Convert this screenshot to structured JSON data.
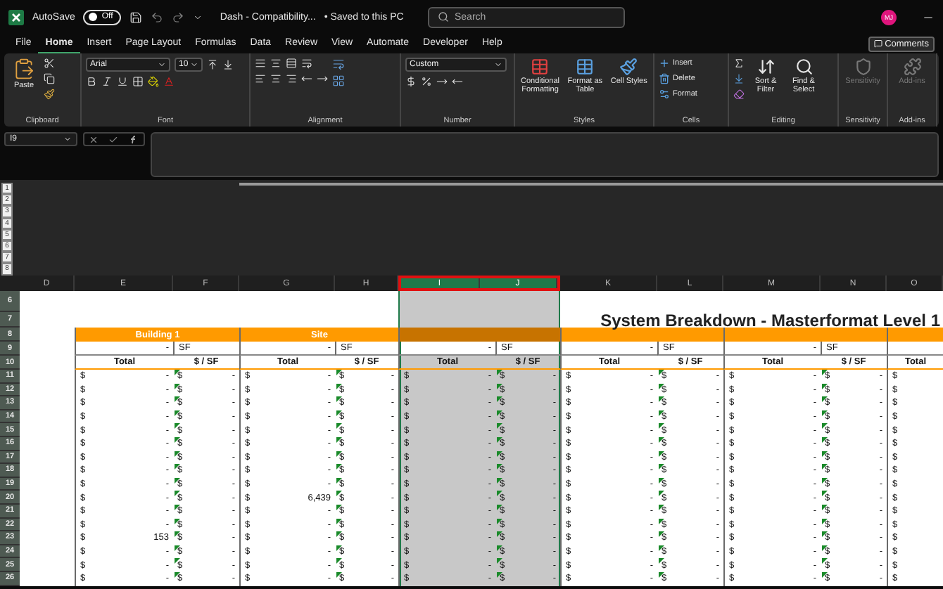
{
  "title_bar": {
    "autosave": {
      "label": "AutoSave",
      "on": false,
      "state_label": "Off"
    },
    "document": "Dash  -  Compatibility...",
    "save_status": "• Saved to this PC",
    "search": {
      "placeholder": "Search"
    },
    "avatar": "MJ"
  },
  "menu": [
    {
      "label": "File",
      "selected": false
    },
    {
      "label": "Home",
      "selected": true
    },
    {
      "label": "Insert",
      "selected": false
    },
    {
      "label": "Page Layout",
      "selected": false
    },
    {
      "label": "Formulas",
      "selected": false
    },
    {
      "label": "Data",
      "selected": false
    },
    {
      "label": "Review",
      "selected": false
    },
    {
      "label": "View",
      "selected": false
    },
    {
      "label": "Automate",
      "selected": false
    },
    {
      "label": "Developer",
      "selected": false
    },
    {
      "label": "Help",
      "selected": false
    }
  ],
  "comments_button": "Comments",
  "ribbon": [
    {
      "kind": "clipboard",
      "name": "Clipboard",
      "buttons": [
        {
          "label": "Paste",
          "disabled": false
        }
      ]
    },
    {
      "kind": "font",
      "name": "Font",
      "font": "Arial",
      "size": "10"
    },
    {
      "kind": "alignment",
      "name": "Alignment"
    },
    {
      "kind": "number",
      "name": "Number",
      "format": "Custom"
    },
    {
      "kind": "styles",
      "name": "Styles",
      "buttons": [
        {
          "label": "Conditional Formatting",
          "disabled": false
        },
        {
          "label": "Format as Table",
          "disabled": false
        },
        {
          "label": "Cell Styles",
          "disabled": false
        }
      ]
    },
    {
      "kind": "cells",
      "name": "Cells",
      "buttons": [
        {
          "label": "Insert",
          "disabled": false
        },
        {
          "label": "Delete",
          "disabled": false
        },
        {
          "label": "Format",
          "disabled": false
        }
      ]
    },
    {
      "kind": "editing",
      "name": "Editing",
      "buttons": [
        {
          "label": "Sort & Filter",
          "disabled": false
        },
        {
          "label": "Find & Select",
          "disabled": false
        }
      ]
    },
    {
      "kind": "single",
      "name": "Sensitivity",
      "buttons": [
        {
          "label": "Sensitivity",
          "disabled": true
        }
      ]
    },
    {
      "kind": "single",
      "name": "Add-ins",
      "buttons": [
        {
          "label": "Add-ins",
          "disabled": true
        }
      ]
    }
  ],
  "formula_bar": {
    "name_box": "I9"
  },
  "top_pane": {
    "rows": [
      "1",
      "2",
      "3",
      "4",
      "5",
      "6",
      "7",
      "8"
    ]
  },
  "sheet": {
    "columns": [
      {
        "letter": "D",
        "selected": false
      },
      {
        "letter": "E",
        "selected": false
      },
      {
        "letter": "F",
        "selected": false
      },
      {
        "letter": "G",
        "selected": false
      },
      {
        "letter": "H",
        "selected": false
      },
      {
        "letter": "I",
        "selected": true
      },
      {
        "letter": "J",
        "selected": true
      },
      {
        "letter": "K",
        "selected": false
      },
      {
        "letter": "L",
        "selected": false
      },
      {
        "letter": "M",
        "selected": false
      },
      {
        "letter": "N",
        "selected": false
      },
      {
        "letter": "O",
        "selected": false
      }
    ],
    "rows": [
      {
        "number": "6",
        "kind": "blank"
      },
      {
        "number": "7",
        "kind": "title",
        "text": "System Breakdown - Masterformat Level 1"
      },
      {
        "number": "8",
        "kind": "block_header",
        "blocks": [
          {
            "label": "Building 1",
            "selected": false
          },
          {
            "label": "Site",
            "selected": false
          },
          {
            "selected": true
          },
          {
            "selected": false
          },
          {
            "selected": false
          },
          {
            "selected": false
          }
        ]
      },
      {
        "number": "9",
        "kind": "area",
        "cells": [
          [
            "-",
            "SF"
          ],
          [
            "-",
            "SF"
          ],
          [
            "-",
            "SF"
          ],
          [
            "-",
            "SF"
          ],
          [
            "-",
            "SF"
          ],
          []
        ]
      },
      {
        "number": "10",
        "kind": "heading",
        "cells": [
          [
            "Total",
            "$ / SF"
          ],
          [
            "Total",
            "$ / SF"
          ],
          [
            "Total",
            "$ / SF"
          ],
          [
            "Total",
            "$ / SF"
          ],
          [
            "Total",
            "$ / SF"
          ],
          [
            "Total"
          ]
        ]
      },
      {
        "number": "11",
        "kind": "data",
        "flagged": true,
        "cells": [
          [
            "$",
            "-",
            "$",
            "-"
          ],
          [
            "$",
            "-",
            "$",
            "-"
          ],
          [
            "$",
            "-",
            "$",
            "-"
          ],
          [
            "$",
            "-",
            "$",
            "-"
          ],
          [
            "$",
            "-",
            "$",
            "-"
          ],
          [
            "$"
          ]
        ]
      },
      {
        "number": "12",
        "kind": "data",
        "flagged": true,
        "cells": [
          [
            "$",
            "-",
            "$",
            "-"
          ],
          [
            "$",
            "-",
            "$",
            "-"
          ],
          [
            "$",
            "-",
            "$",
            "-"
          ],
          [
            "$",
            "-",
            "$",
            "-"
          ],
          [
            "$",
            "-",
            "$",
            "-"
          ],
          [
            "$"
          ]
        ]
      },
      {
        "number": "13",
        "kind": "data",
        "flagged": true,
        "cells": [
          [
            "$",
            "-",
            "$",
            "-"
          ],
          [
            "$",
            "-",
            "$",
            "-"
          ],
          [
            "$",
            "-",
            "$",
            "-"
          ],
          [
            "$",
            "-",
            "$",
            "-"
          ],
          [
            "$",
            "-",
            "$",
            "-"
          ],
          [
            "$"
          ]
        ]
      },
      {
        "number": "14",
        "kind": "data",
        "flagged": true,
        "cells": [
          [
            "$",
            "-",
            "$",
            "-"
          ],
          [
            "$",
            "-",
            "$",
            "-"
          ],
          [
            "$",
            "-",
            "$",
            "-"
          ],
          [
            "$",
            "-",
            "$",
            "-"
          ],
          [
            "$",
            "-",
            "$",
            "-"
          ],
          [
            "$"
          ]
        ]
      },
      {
        "number": "15",
        "kind": "data",
        "flagged": true,
        "cells": [
          [
            "$",
            "-",
            "$",
            "-"
          ],
          [
            "$",
            "-",
            "$",
            "-"
          ],
          [
            "$",
            "-",
            "$",
            "-"
          ],
          [
            "$",
            "-",
            "$",
            "-"
          ],
          [
            "$",
            "-",
            "$",
            "-"
          ],
          [
            "$"
          ]
        ]
      },
      {
        "number": "16",
        "kind": "data",
        "flagged": true,
        "cells": [
          [
            "$",
            "-",
            "$",
            "-"
          ],
          [
            "$",
            "-",
            "$",
            "-"
          ],
          [
            "$",
            "-",
            "$",
            "-"
          ],
          [
            "$",
            "-",
            "$",
            "-"
          ],
          [
            "$",
            "-",
            "$",
            "-"
          ],
          [
            "$"
          ]
        ]
      },
      {
        "number": "17",
        "kind": "data",
        "flagged": true,
        "cells": [
          [
            "$",
            "-",
            "$",
            "-"
          ],
          [
            "$",
            "-",
            "$",
            "-"
          ],
          [
            "$",
            "-",
            "$",
            "-"
          ],
          [
            "$",
            "-",
            "$",
            "-"
          ],
          [
            "$",
            "-",
            "$",
            "-"
          ],
          [
            "$"
          ]
        ]
      },
      {
        "number": "18",
        "kind": "data",
        "flagged": true,
        "cells": [
          [
            "$",
            "-",
            "$",
            "-"
          ],
          [
            "$",
            "-",
            "$",
            "-"
          ],
          [
            "$",
            "-",
            "$",
            "-"
          ],
          [
            "$",
            "-",
            "$",
            "-"
          ],
          [
            "$",
            "-",
            "$",
            "-"
          ],
          [
            "$"
          ]
        ]
      },
      {
        "number": "19",
        "kind": "data",
        "flagged": true,
        "cells": [
          [
            "$",
            "-",
            "$",
            "-"
          ],
          [
            "$",
            "-",
            "$",
            "-"
          ],
          [
            "$",
            "-",
            "$",
            "-"
          ],
          [
            "$",
            "-",
            "$",
            "-"
          ],
          [
            "$",
            "-",
            "$",
            "-"
          ],
          [
            "$"
          ]
        ]
      },
      {
        "number": "20",
        "kind": "data",
        "flagged": true,
        "cells": [
          [
            "$",
            "-",
            "$",
            "-"
          ],
          [
            "$",
            "6,439",
            "$",
            "-"
          ],
          [
            "$",
            "-",
            "$",
            "-"
          ],
          [
            "$",
            "-",
            "$",
            "-"
          ],
          [
            "$",
            "-",
            "$",
            "-"
          ],
          [
            "$"
          ]
        ]
      },
      {
        "number": "21",
        "kind": "data",
        "flagged": true,
        "cells": [
          [
            "$",
            "-",
            "$",
            "-"
          ],
          [
            "$",
            "-",
            "$",
            "-"
          ],
          [
            "$",
            "-",
            "$",
            "-"
          ],
          [
            "$",
            "-",
            "$",
            "-"
          ],
          [
            "$",
            "-",
            "$",
            "-"
          ],
          [
            "$"
          ]
        ]
      },
      {
        "number": "22",
        "kind": "data",
        "flagged": true,
        "cells": [
          [
            "$",
            "-",
            "$",
            "-"
          ],
          [
            "$",
            "-",
            "$",
            "-"
          ],
          [
            "$",
            "-",
            "$",
            "-"
          ],
          [
            "$",
            "-",
            "$",
            "-"
          ],
          [
            "$",
            "-",
            "$",
            "-"
          ],
          [
            "$"
          ]
        ]
      },
      {
        "number": "23",
        "kind": "data",
        "flagged": true,
        "cells": [
          [
            "$",
            "153",
            "$",
            "-"
          ],
          [
            "$",
            "-",
            "$",
            "-"
          ],
          [
            "$",
            "-",
            "$",
            "-"
          ],
          [
            "$",
            "-",
            "$",
            "-"
          ],
          [
            "$",
            "-",
            "$",
            "-"
          ],
          [
            "$"
          ]
        ]
      },
      {
        "number": "24",
        "kind": "data",
        "flagged": true,
        "cells": [
          [
            "$",
            "-",
            "$",
            "-"
          ],
          [
            "$",
            "-",
            "$",
            "-"
          ],
          [
            "$",
            "-",
            "$",
            "-"
          ],
          [
            "$",
            "-",
            "$",
            "-"
          ],
          [
            "$",
            "-",
            "$",
            "-"
          ],
          [
            "$"
          ]
        ]
      },
      {
        "number": "25",
        "kind": "data",
        "flagged": true,
        "cells": [
          [
            "$",
            "-",
            "$",
            "-"
          ],
          [
            "$",
            "-",
            "$",
            "-"
          ],
          [
            "$",
            "-",
            "$",
            "-"
          ],
          [
            "$",
            "-",
            "$",
            "-"
          ],
          [
            "$",
            "-",
            "$",
            "-"
          ],
          [
            "$"
          ]
        ]
      },
      {
        "number": "26",
        "kind": "data",
        "flagged": true,
        "cells": [
          [
            "$",
            "-",
            "$",
            "-"
          ],
          [
            "$",
            "-",
            "$",
            "-"
          ],
          [
            "$",
            "-",
            "$",
            "-"
          ],
          [
            "$",
            "-",
            "$",
            "-"
          ],
          [
            "$",
            "-",
            "$",
            "-"
          ],
          [
            "$"
          ]
        ]
      }
    ]
  }
}
